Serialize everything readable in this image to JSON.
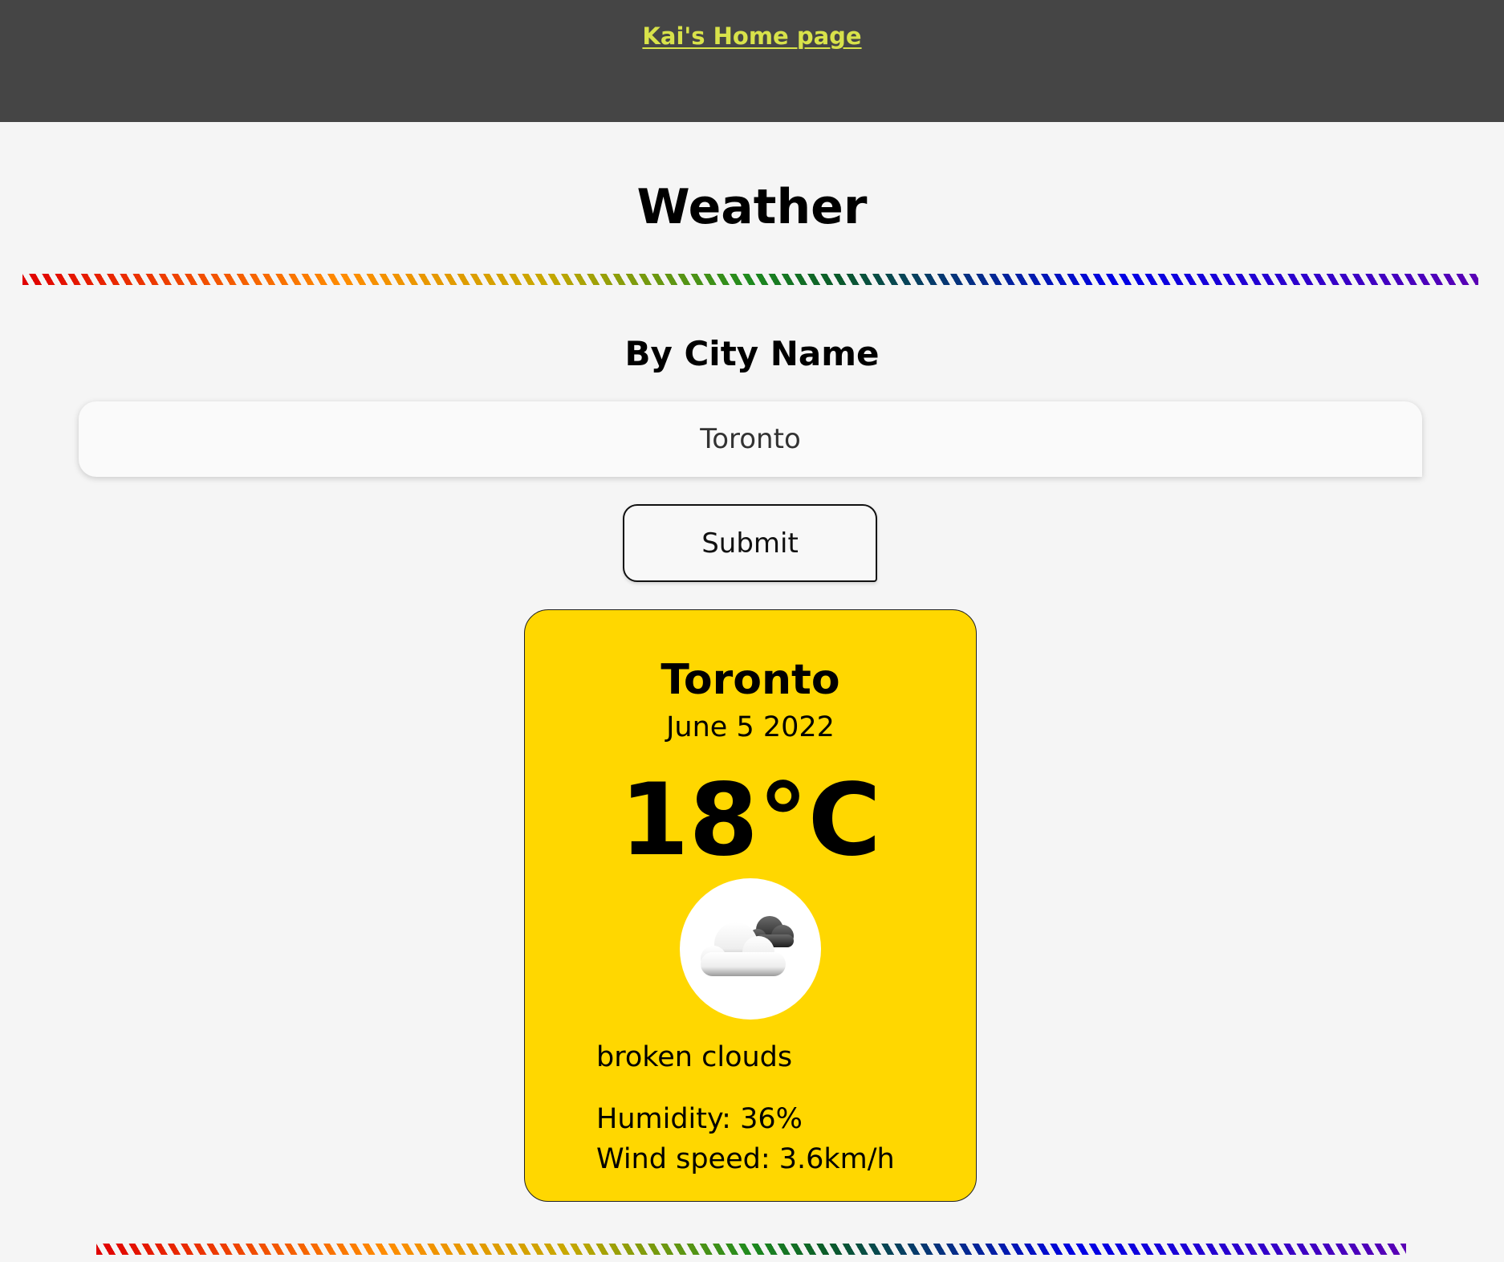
{
  "header": {
    "home_link": "Kai's Home page"
  },
  "page": {
    "title": "Weather",
    "section_title": "By City Name"
  },
  "search": {
    "value": "Toronto",
    "submit_label": "Submit"
  },
  "card": {
    "city": "Toronto",
    "date": "June 5 2022",
    "temperature": "18°C",
    "icon": "broken-clouds-icon",
    "description": "broken clouds",
    "humidity": "Humidity: 36%",
    "wind": "Wind speed: 3.6km/h"
  },
  "colors": {
    "header_bg": "#454545",
    "link": "#d8e24a",
    "card_bg": "#ffd700",
    "page_bg": "#f5f5f5"
  }
}
